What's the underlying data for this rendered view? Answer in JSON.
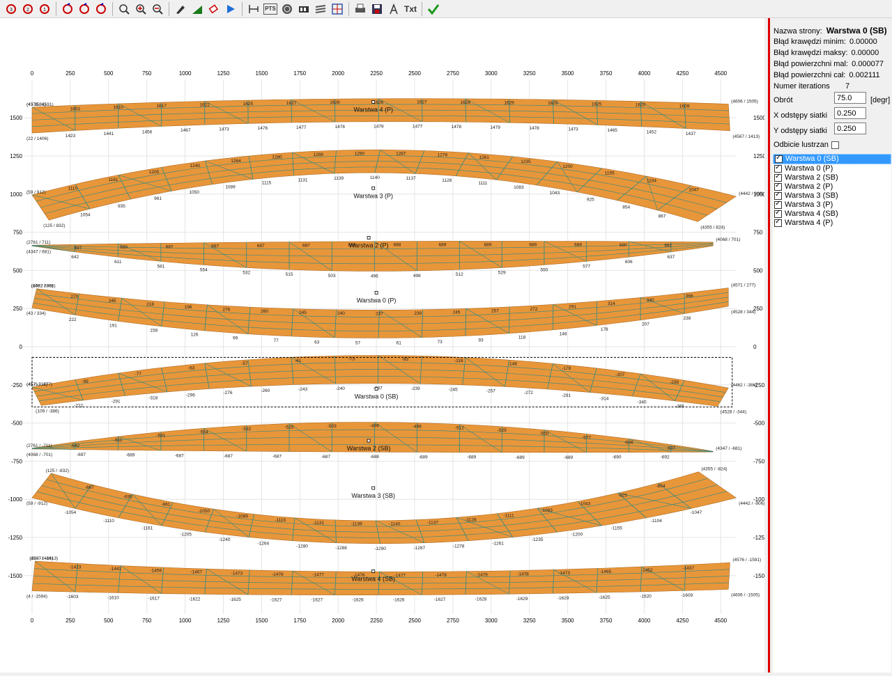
{
  "toolbar": {
    "buttons": [
      "rotate-left-3",
      "rotate-ccw",
      "rotate-right-3",
      "rotate-cw-1",
      "rotate-cw-2",
      "rotate-cw-3",
      "zoom-extents",
      "zoom-in",
      "zoom-out",
      "edit",
      "fill",
      "erase",
      "play",
      "dimension",
      "pts",
      "globe",
      "film",
      "layers",
      "grid",
      "print",
      "save",
      "measure",
      "txt",
      "apply"
    ],
    "pts_label": "PTS",
    "txt_label": "Txt"
  },
  "panel": {
    "page_name_label": "Nazwa strony:",
    "page_name_value": "Warstwa 0 (SB)",
    "edge_min_label": "Błąd krawędzi minim:",
    "edge_min_value": "0.00000",
    "edge_max_label": "Błąd krawędzi maksy:",
    "edge_max_value": "0.00000",
    "surf_min_label": "Błąd powierzchni mal:",
    "surf_min_value": "0.000077",
    "surf_total_label": "Błąd powierzchni cał:",
    "surf_total_value": "0.002111",
    "iterations_label": "Numer iterations",
    "iterations_value": "7",
    "rotation_label": "Obrót",
    "rotation_value": "75.0",
    "rotation_unit": "[degr]",
    "x_grid_label": "X odstępy siatki",
    "x_grid_value": "0.250",
    "y_grid_label": "Y odstępy siatki",
    "y_grid_value": "0.250",
    "mirror_label": "Odbicie lustrzane",
    "layers": [
      {
        "name": "Warstwa 0 (SB)",
        "checked": true,
        "selected": true
      },
      {
        "name": "Warstwa 0 (P)",
        "checked": true,
        "selected": false
      },
      {
        "name": "Warstwa 2 (SB)",
        "checked": true,
        "selected": false
      },
      {
        "name": "Warstwa 2 (P)",
        "checked": true,
        "selected": false
      },
      {
        "name": "Warstwa 3 (SB)",
        "checked": true,
        "selected": false
      },
      {
        "name": "Warstwa 3 (P)",
        "checked": true,
        "selected": false
      },
      {
        "name": "Warstwa 4 (SB)",
        "checked": true,
        "selected": false
      },
      {
        "name": "Warstwa 4 (P)",
        "checked": true,
        "selected": false
      }
    ]
  },
  "plot": {
    "x_ticks": [
      "0",
      "250",
      "500",
      "750",
      "1000",
      "1250",
      "1500",
      "1750",
      "2000",
      "2250",
      "2500",
      "2750",
      "3000",
      "3250",
      "3500",
      "3750",
      "4000",
      "4250",
      "4500"
    ],
    "y_ticks": [
      "1500",
      "1250",
      "1000",
      "750",
      "500",
      "250",
      "0",
      "-250",
      "-500",
      "-750",
      "-1000",
      "-1250",
      "-1500"
    ],
    "fill_color": "#e8963a",
    "mesh_color": "#2a8a86",
    "strips": [
      {
        "label": "Warstwa 4 (P)",
        "top_labels": [
          "1603",
          "1610",
          "1617",
          "1622",
          "1625",
          "1627",
          "1626",
          "1626",
          "1627",
          "1628",
          "1629",
          "1629",
          "1625",
          "1620",
          "1609"
        ],
        "bot_labels": [
          "1423",
          "1441",
          "1456",
          "1467",
          "1473",
          "1476",
          "1477",
          "1476",
          "1478",
          "1477",
          "1478",
          "1479",
          "1478",
          "1473",
          "1465",
          "1452",
          "1437"
        ],
        "corner_labels": [
          "(4 / 1594)",
          "(22 / 1406)",
          "(4576 / 1591)",
          "(4567 / 1413)",
          "(4606 / 1505)"
        ]
      },
      {
        "label": "Warstwa 3 (P)",
        "top_labels": [
          "1110",
          "1161",
          "1205",
          "1240",
          "1264",
          "1280",
          "1288",
          "1290",
          "1287",
          "1278",
          "1261",
          "1235",
          "1200",
          "1155",
          "1104",
          "1047"
        ],
        "bot_labels": [
          "1054",
          "935",
          "961",
          "1050",
          "1089",
          "1115",
          "1131",
          "1139",
          "1140",
          "1137",
          "1128",
          "1111",
          "1083",
          "1043",
          "925",
          "854",
          "867"
        ],
        "corner_labels": [
          "(59 / 912)",
          "(125 / 832)",
          "(4442 / 906)",
          "(4355 / 824)"
        ]
      },
      {
        "label": "Warstwa 2 (P)",
        "top_labels": [
          "697",
          "689",
          "687",
          "687",
          "687",
          "687",
          "688",
          "688",
          "689",
          "689",
          "689",
          "689",
          "690",
          "692"
        ],
        "bot_labels": [
          "642",
          "611",
          "581",
          "554",
          "532",
          "515",
          "503",
          "496",
          "496",
          "512",
          "529",
          "550",
          "577",
          "606",
          "637"
        ],
        "corner_labels": [
          "(2761 / 711)",
          "(4347 / 681)",
          "(4068 / 701)"
        ]
      },
      {
        "label": "Warstwa 0 (P)",
        "top_labels": [
          "270",
          "245",
          "218",
          "196",
          "276",
          "260",
          "245",
          "240",
          "237",
          "239",
          "245",
          "257",
          "272",
          "291",
          "314",
          "340",
          "366"
        ],
        "bot_labels": [
          "222",
          "191",
          "158",
          "126",
          "99",
          "77",
          "63",
          "57",
          "61",
          "73",
          "93",
          "118",
          "148",
          "178",
          "207",
          "238"
        ],
        "corner_labels": [
          "(109 / 386)",
          "(43 / 334)",
          "(4462 / 386)",
          "(4528 / 344)",
          "(4571 / 277)"
        ]
      },
      {
        "label": "Warstwa 0 (SB)",
        "top_labels": [
          "-99",
          "-77",
          "-63",
          "-57",
          "-61",
          "-73",
          "-93",
          "-118",
          "-148",
          "-178",
          "-207",
          "-238"
        ],
        "bot_labels": [
          "-222",
          "-291",
          "-318",
          "-296",
          "-276",
          "-260",
          "-243",
          "-240",
          "-237",
          "-239",
          "-245",
          "-257",
          "-272",
          "-291",
          "-314",
          "-340",
          "-366"
        ],
        "corner_labels": [
          "(45 / -334)",
          "(109 / -386)",
          "(4571 / -277)",
          "(4528 / -344)",
          "(4462 / -386)"
        ]
      },
      {
        "label": "Warstwa 2 (SB)",
        "top_labels": [
          "-642",
          "-611",
          "-581",
          "-554",
          "-532",
          "-515",
          "-503",
          "-496",
          "-496",
          "-512",
          "-529",
          "-550",
          "-577",
          "-606",
          "-637"
        ],
        "bot_labels": [
          "-697",
          "-689",
          "-687",
          "-687",
          "-687",
          "-687",
          "-688",
          "-689",
          "-689",
          "-689",
          "-689",
          "-690",
          "-692"
        ],
        "corner_labels": [
          "(2761 / -711)",
          "(4068 / -701)",
          "(4347 / -681)"
        ]
      },
      {
        "label": "Warstwa 3 (SB)",
        "top_labels": [
          "-867",
          "-935",
          "-961",
          "-1050",
          "-1089",
          "-1115",
          "-1131",
          "-1139",
          "-1140",
          "-1137",
          "-1128",
          "-1111",
          "-1083",
          "-1043",
          "-925",
          "-854"
        ],
        "bot_labels": [
          "-1054",
          "-1110",
          "-1161",
          "-1205",
          "-1240",
          "-1264",
          "-1280",
          "-1288",
          "-1290",
          "-1287",
          "-1278",
          "-1261",
          "-1235",
          "-1200",
          "-1155",
          "-1104",
          "-1047"
        ],
        "corner_labels": [
          "(125 / -832)",
          "(59 / -912)",
          "(4355 / -824)",
          "(4442 / -906)"
        ]
      },
      {
        "label": "Warstwa 4 (SB)",
        "top_labels": [
          "-1423",
          "-1441",
          "-1456",
          "-1467",
          "-1473",
          "-1476",
          "-1477",
          "-1476",
          "-1477",
          "-1478",
          "-1479",
          "-1478",
          "-1473",
          "-1465",
          "-1452",
          "-1437"
        ],
        "bot_labels": [
          "-1603",
          "-1610",
          "-1617",
          "-1622",
          "-1625",
          "-1627",
          "-1627",
          "-1626",
          "-1626",
          "-1627",
          "-1628",
          "-1629",
          "-1629",
          "-1625",
          "-1620",
          "-1609"
        ],
        "corner_labels": [
          "(22 / -1406)",
          "(4 / -1594)",
          "(4567 / -1413)",
          "(4606 / -1505)",
          "(4576 / -1591)"
        ]
      }
    ]
  }
}
